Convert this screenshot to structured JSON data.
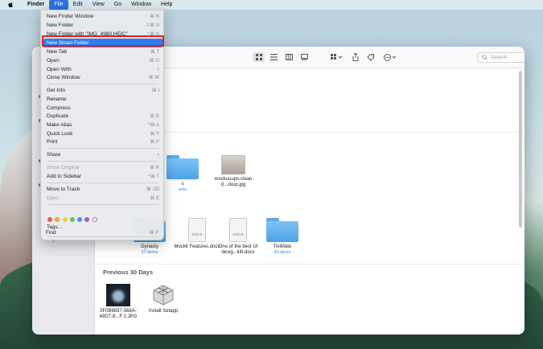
{
  "menubar": {
    "items": [
      "Finder",
      "File",
      "Edit",
      "View",
      "Go",
      "Window",
      "Help"
    ]
  },
  "menu": {
    "items": [
      {
        "label": "New Finder Window",
        "shortcut": "⌘ N"
      },
      {
        "label": "New Folder",
        "shortcut": "⇧⌘ N"
      },
      {
        "label": "New Folder with \"IMG_4980.HEIC\"",
        "shortcut": "^⌘ N"
      },
      {
        "label": "New Smart Folder",
        "shortcut": ""
      },
      {
        "label": "New Tab",
        "shortcut": "⌘ T"
      },
      {
        "label": "Open",
        "shortcut": "⌘ O"
      },
      {
        "label": "Open With",
        "shortcut": ""
      },
      {
        "label": "Close Window",
        "shortcut": "⌘ W"
      },
      {
        "label": "Get Info",
        "shortcut": "⌘ I"
      },
      {
        "label": "Rename",
        "shortcut": ""
      },
      {
        "label": "Compress",
        "shortcut": ""
      },
      {
        "label": "Duplicate",
        "shortcut": "⌘ D"
      },
      {
        "label": "Make Alias",
        "shortcut": "^⌘ A"
      },
      {
        "label": "Quick Look",
        "shortcut": "⌘ Y"
      },
      {
        "label": "Print",
        "shortcut": "⌘ P"
      },
      {
        "label": "Share",
        "shortcut": ""
      },
      {
        "label": "Show Original",
        "shortcut": "⌘ R"
      },
      {
        "label": "Add to Sidebar",
        "shortcut": "^⌘ T"
      },
      {
        "label": "Move to Trash",
        "shortcut": "⌘ ⌫"
      },
      {
        "label": "Eject",
        "shortcut": "⌘ E"
      },
      {
        "label": "Tags...",
        "shortcut": ""
      },
      {
        "label": "Find",
        "shortcut": "⌘ F"
      }
    ],
    "tag_colors": [
      "#ec5b55",
      "#f3a33b",
      "#f5cd3b",
      "#5fc35a",
      "#3f8ff0",
      "#a35bd3",
      "#ffffff"
    ]
  },
  "toolbar": {
    "search_placeholder": "Search"
  },
  "files": {
    "row1": [
      {
        "name": "s",
        "sub": "ems"
      },
      {
        "name": "mockuuups-clean d...ckup.jpg",
        "sub": ""
      }
    ],
    "row2": [
      {
        "name": "Dynasty",
        "sub": "27 items"
      },
      {
        "name": "Mocklt Features.docx",
        "sub": ""
      },
      {
        "name": "One of the best UI desig...kitt.docx",
        "sub": ""
      },
      {
        "name": "TiviMate",
        "sub": "43 items"
      }
    ],
    "group_previous": "Previous 30 Days",
    "row3": [
      {
        "name": "3F0B9837-568A-49D7-8...F 2.JPG",
        "sub": ""
      },
      {
        "name": "Install Setapp",
        "sub": ""
      }
    ]
  },
  "sidebar": {
    "partial_label": "Tag"
  }
}
